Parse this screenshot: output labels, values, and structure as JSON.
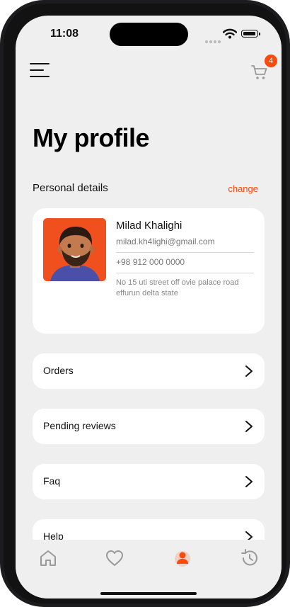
{
  "status_bar": {
    "time": "11:08"
  },
  "header": {
    "cart_count": "4"
  },
  "page": {
    "title": "My profile"
  },
  "personal_details": {
    "section_title": "Personal details",
    "change_label": "change"
  },
  "profile": {
    "name": "Milad Khalighi",
    "email": "milad.kh4lighi@gmail.com",
    "phone": "+98 912 000 0000",
    "address": "No 15 uti street off ovie palace road effurun delta state"
  },
  "menu": {
    "items": [
      {
        "label": "Orders"
      },
      {
        "label": "Pending reviews"
      },
      {
        "label": "Faq"
      },
      {
        "label": "Help"
      }
    ]
  },
  "tab_bar": {
    "tabs": [
      {
        "icon": "home-icon"
      },
      {
        "icon": "heart-icon"
      },
      {
        "icon": "user-icon"
      },
      {
        "icon": "history-icon"
      }
    ],
    "active_tab": "user-icon"
  },
  "colors": {
    "accent": "#fa4a0c",
    "background": "#efefef",
    "card": "#ffffff"
  }
}
